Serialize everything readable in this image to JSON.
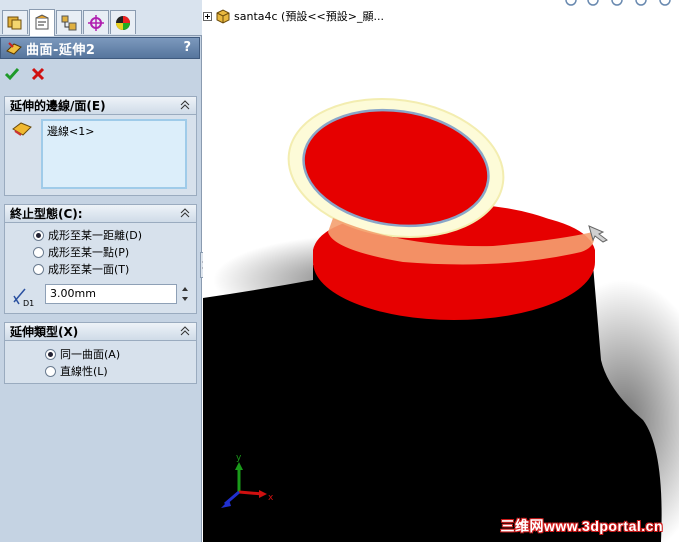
{
  "panel": {
    "tabs": [
      {
        "icon": "feature-manager-icon"
      },
      {
        "icon": "property-manager-icon"
      },
      {
        "icon": "configuration-manager-icon"
      },
      {
        "icon": "dimxpert-icon"
      },
      {
        "icon": "display-manager-icon"
      }
    ],
    "title": "曲面-延伸2",
    "help": "?",
    "groups": {
      "edges": {
        "label": "延伸的邊線/面(E)",
        "selection": "邊線<1>"
      },
      "end_condition": {
        "label": "終止型態(C):",
        "options": [
          {
            "label": "成形至某一距離(D)",
            "selected": true
          },
          {
            "label": "成形至某一點(P)",
            "selected": false
          },
          {
            "label": "成形至某一面(T)",
            "selected": false
          }
        ],
        "distance_value": "3.00mm"
      },
      "extension_type": {
        "label": "延伸類型(X)",
        "options": [
          {
            "label": "同一曲面(A)",
            "selected": true
          },
          {
            "label": "直線性(L)",
            "selected": false
          }
        ]
      }
    }
  },
  "graphics": {
    "tree_label": "santa4c (預設<<預設>_顯...",
    "triad": {
      "x": "x",
      "y": "y"
    },
    "watermark": "三维网www.3dportal.cn",
    "colors": {
      "face_red": "#e60000",
      "highlight": "#fdfbd8",
      "edge_blue": "#8aa6c8"
    }
  }
}
